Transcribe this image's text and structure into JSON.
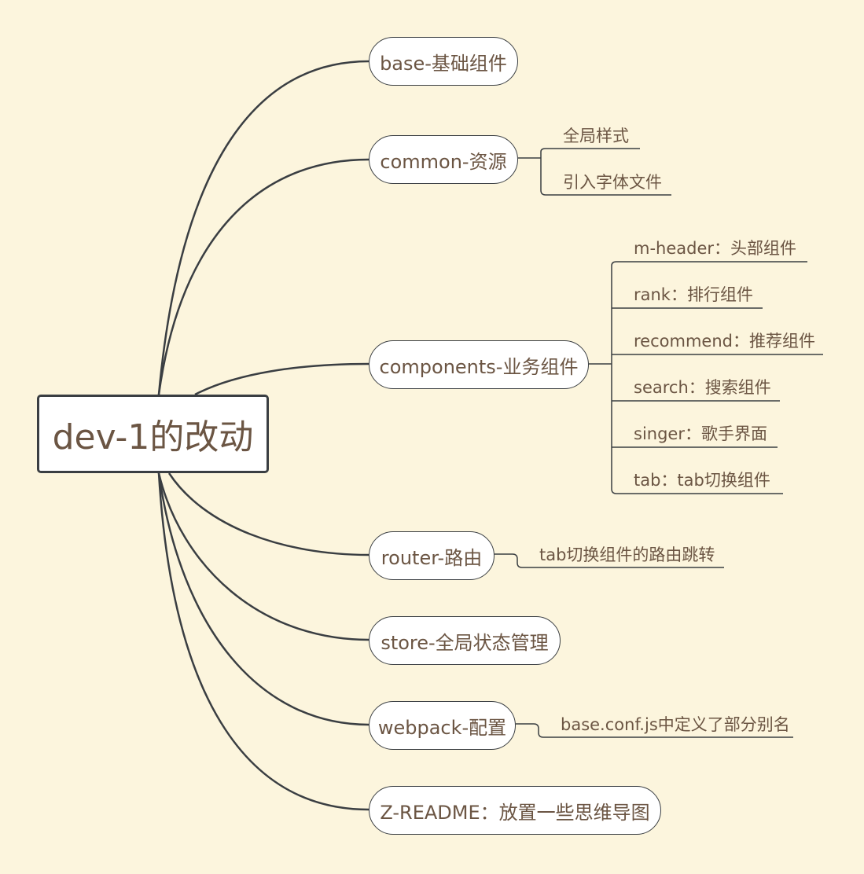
{
  "root": {
    "label": "dev-1的改动"
  },
  "branches": {
    "base": {
      "label": "base-基础组件"
    },
    "common": {
      "label": "common-资源",
      "children": [
        "全局样式",
        "引入字体文件"
      ]
    },
    "components": {
      "label": "components-业务组件",
      "children": [
        "m-header：头部组件",
        "rank：排行组件",
        "recommend：推荐组件",
        "search：搜索组件",
        "singer：歌手界面",
        "tab：tab切换组件"
      ]
    },
    "router": {
      "label": "router-路由",
      "children": [
        "tab切换组件的路由跳转"
      ]
    },
    "store": {
      "label": "store-全局状态管理"
    },
    "webpack": {
      "label": "webpack-配置",
      "children": [
        "base.conf.js中定义了部分别名"
      ]
    },
    "readme": {
      "label": "Z-README：放置一些思维导图"
    }
  },
  "colors": {
    "background": "#fcf5dd",
    "line": "#3a3e42",
    "text": "#6b5543",
    "node_fill": "#ffffff"
  }
}
